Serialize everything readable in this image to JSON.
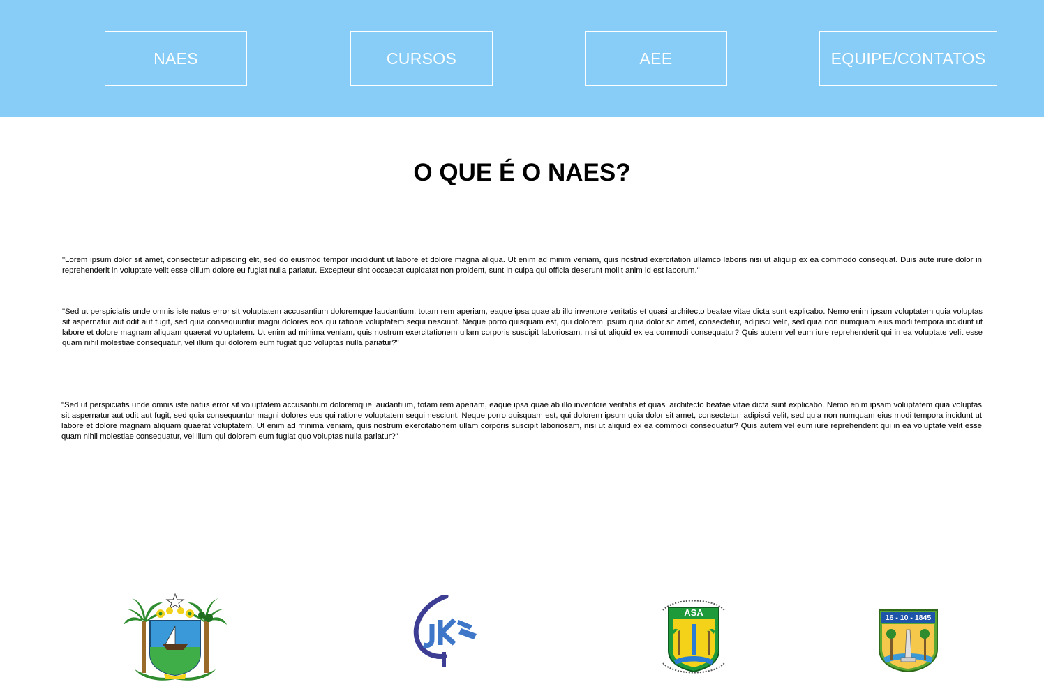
{
  "nav": {
    "items": [
      {
        "label": "NAES"
      },
      {
        "label": "CURSOS"
      },
      {
        "label": "AEE"
      },
      {
        "label": "EQUIPE/CONTATOS"
      }
    ]
  },
  "main": {
    "title": "O QUE É O NAES?",
    "paragraphs": [
      "\"Lorem ipsum dolor sit amet, consectetur adipiscing elit, sed do eiusmod tempor incididunt ut labore et dolore magna aliqua. Ut enim ad minim veniam, quis nostrud exercitation ullamco laboris nisi ut aliquip ex ea commodo consequat. Duis aute irure dolor in reprehenderit in voluptate velit esse cillum dolore eu fugiat nulla pariatur. Excepteur sint occaecat cupidatat non proident, sunt in culpa qui officia deserunt mollit anim id est laborum.\"",
      "\"Sed ut perspiciatis unde omnis iste natus error sit voluptatem accusantium doloremque laudantium, totam rem aperiam, eaque ipsa quae ab illo inventore veritatis et quasi architecto beatae vitae dicta sunt explicabo. Nemo enim ipsam voluptatem quia voluptas sit aspernatur aut odit aut fugit, sed quia consequuntur magni dolores eos qui ratione voluptatem sequi nesciunt. Neque porro quisquam est, qui dolorem ipsum quia dolor sit amet, consectetur, adipisci velit, sed quia non numquam eius modi tempora incidunt ut labore et dolore magnam aliquam quaerat voluptatem. Ut enim ad minima veniam, quis nostrum exercitationem ullam corporis suscipit laboriosam, nisi ut aliquid ex ea commodi consequatur? Quis autem vel eum iure reprehenderit qui in ea voluptate velit esse quam nihil molestiae consequatur, vel illum qui dolorem eum fugiat quo voluptas nulla pariatur?\"",
      "\"Sed ut perspiciatis unde omnis iste natus error sit voluptatem accusantium doloremque laudantium, totam rem aperiam, eaque ipsa quae ab illo inventore veritatis et quasi architecto beatae vitae dicta sunt explicabo. Nemo enim ipsam voluptatem quia voluptas sit aspernatur aut odit aut fugit, sed quia consequuntur magni dolores eos qui ratione voluptatem sequi nesciunt. Neque porro quisquam est, qui dolorem ipsum quia dolor sit amet, consectetur, adipisci velit, sed quia non numquam eius modi tempora incidunt ut labore et dolore magnam aliquam quaerat voluptatem. Ut enim ad minima veniam, quis nostrum exercitationem ullam corporis suscipit laboriosam, nisi ut aliquid ex ea commodi consequatur? Quis autem vel eum iure reprehenderit qui in ea voluptate velit esse quam nihil molestiae consequatur, vel illum qui dolorem eum fugiat quo voluptas nulla pariatur?\""
    ]
  },
  "footer": {
    "logos": [
      {
        "icon": "state-coat-of-arms-icon"
      },
      {
        "icon": "jk-school-logo-icon"
      },
      {
        "icon": "asa-association-logo-icon",
        "text": "ASA"
      },
      {
        "icon": "city-shield-logo-icon",
        "text": "16 - 10 - 1845"
      }
    ]
  },
  "colors": {
    "header_bg": "#87cdf8",
    "nav_text": "#ffffff",
    "body_text": "#000000"
  }
}
